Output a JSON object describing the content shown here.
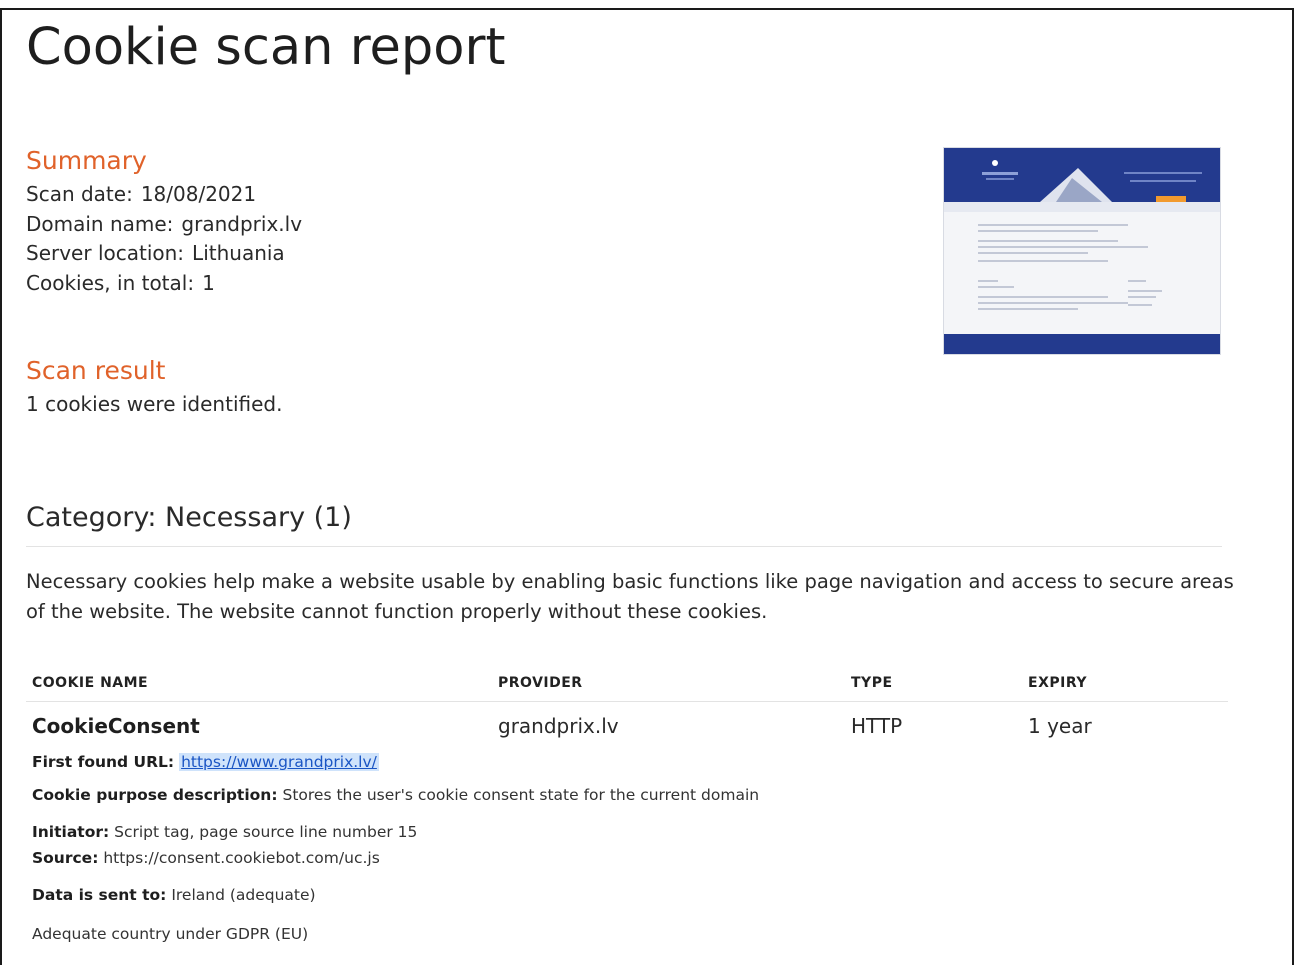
{
  "report": {
    "title": "Cookie scan report"
  },
  "summary": {
    "heading": "Summary",
    "rows": [
      {
        "label": "Scan date:",
        "value": "18/08/2021"
      },
      {
        "label": "Domain name:",
        "value": "grandprix.lv"
      },
      {
        "label": "Server location:",
        "value": "Lithuania"
      },
      {
        "label": "Cookies, in total:",
        "value": "1"
      }
    ]
  },
  "scan_result": {
    "heading": "Scan result",
    "text": "1 cookies were identified."
  },
  "category": {
    "title": "Category: Necessary (1)",
    "description": "Necessary cookies help make a website usable by enabling basic functions like page navigation and access to secure areas of the website. The website cannot function properly without these cookies."
  },
  "table": {
    "headers": {
      "name": "COOKIE NAME",
      "provider": "PROVIDER",
      "type": "TYPE",
      "expiry": "EXPIRY"
    },
    "rows": [
      {
        "name": "CookieConsent",
        "provider": "grandprix.lv",
        "type": "HTTP",
        "expiry": "1 year",
        "first_found_label": "First found URL:",
        "first_found_url": "https://www.grandprix.lv/",
        "purpose_label": "Cookie purpose description:",
        "purpose": "Stores the user's cookie consent state for the current domain",
        "initiator_label": "Initiator:",
        "initiator": "Script tag, page source line number 15",
        "source_label": "Source:",
        "source": "https://consent.cookiebot.com/uc.js",
        "sent_to_label": "Data is sent to:",
        "sent_to": "Ireland (adequate)",
        "adequate_note": "Adequate country under GDPR (EU)"
      }
    ]
  },
  "colors": {
    "section_heading": "#e0622a",
    "link": "#1a55c4",
    "link_highlight": "#cfe3fb",
    "thumbnail_brand": "#233a8e"
  }
}
